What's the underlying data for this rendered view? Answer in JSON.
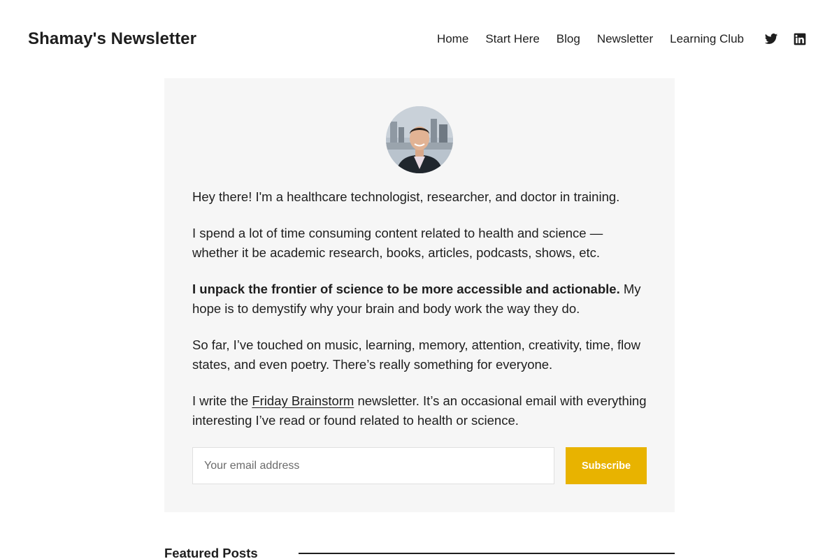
{
  "header": {
    "site_title": "Shamay's Newsletter",
    "nav": [
      {
        "label": "Home"
      },
      {
        "label": "Start Here"
      },
      {
        "label": "Blog"
      },
      {
        "label": "Newsletter"
      },
      {
        "label": "Learning Club"
      }
    ],
    "social": [
      "twitter-icon",
      "linkedin-icon"
    ]
  },
  "intro": {
    "p1": "Hey there! I'm a healthcare technologist, researcher, and doctor in training.",
    "p2": "I spend a lot of time consuming content related to health and science — whether it be academic research, books, articles, podcasts, shows, etc.",
    "p3_bold": "I unpack the frontier of science to be more accessible and actionable.",
    "p3_rest": " My hope is to demystify why your brain and body work the way they do.",
    "p4": "So far, I’ve touched on music, learning, memory, attention, creativity, time, flow states, and even poetry. There’s really something for everyone.",
    "p5_before": "I write the ",
    "p5_link": "Friday Brainstorm",
    "p5_after": " newsletter. It’s an occasional email with everything interesting I’ve read or found related to health or science."
  },
  "signup": {
    "email_placeholder": "Your email address",
    "email_value": "",
    "subscribe_label": "Subscribe"
  },
  "featured": {
    "title": "Featured Posts"
  },
  "colors": {
    "accent": "#e8b300",
    "card_bg": "#f6f6f6",
    "text": "#1e1e1e"
  }
}
